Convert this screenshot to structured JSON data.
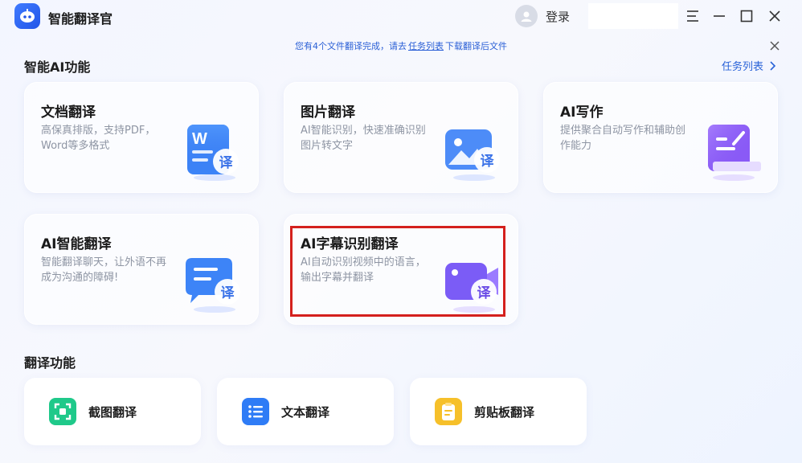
{
  "app": {
    "title": "智能翻译官"
  },
  "titlebar": {
    "login_label": "登录"
  },
  "notice": {
    "text_before": "您有4个文件翻译完成，请去",
    "link_text": "任务列表",
    "text_after": "下载翻译后文件"
  },
  "sections": {
    "ai_title": "智能AI功能",
    "task_list_link": "任务列表",
    "translate_title": "翻译功能"
  },
  "cards": [
    {
      "title": "文档翻译",
      "desc": "高保真排版，支持PDF，Word等多格式",
      "badge": "译",
      "icon": "word-document-icon"
    },
    {
      "title": "图片翻译",
      "desc": "AI智能识别，快速准确识别图片转文字",
      "badge": "译",
      "icon": "image-icon"
    },
    {
      "title": "AI写作",
      "desc": "提供聚合自动写作和辅助创作能力",
      "badge": "",
      "icon": "writing-pad-icon"
    },
    {
      "title": "AI智能翻译",
      "desc": "智能翻译聊天，让外语不再成为沟通的障碍!",
      "badge": "译",
      "icon": "chat-bubble-icon"
    },
    {
      "title": "AI字幕识别翻译",
      "desc": "AI自动识别视频中的语言，输出字幕并翻译",
      "badge": "译",
      "icon": "video-camera-icon"
    }
  ],
  "tools": [
    {
      "label": "截图翻译",
      "icon": "screenshot-icon",
      "color": "#1fc98a"
    },
    {
      "label": "文本翻译",
      "icon": "text-list-icon",
      "color": "#2f7cf6"
    },
    {
      "label": "剪贴板翻译",
      "icon": "clipboard-icon",
      "color": "#f6c02a"
    }
  ],
  "colors": {
    "accent": "#2a63d8",
    "highlight_border": "#d4201d"
  }
}
